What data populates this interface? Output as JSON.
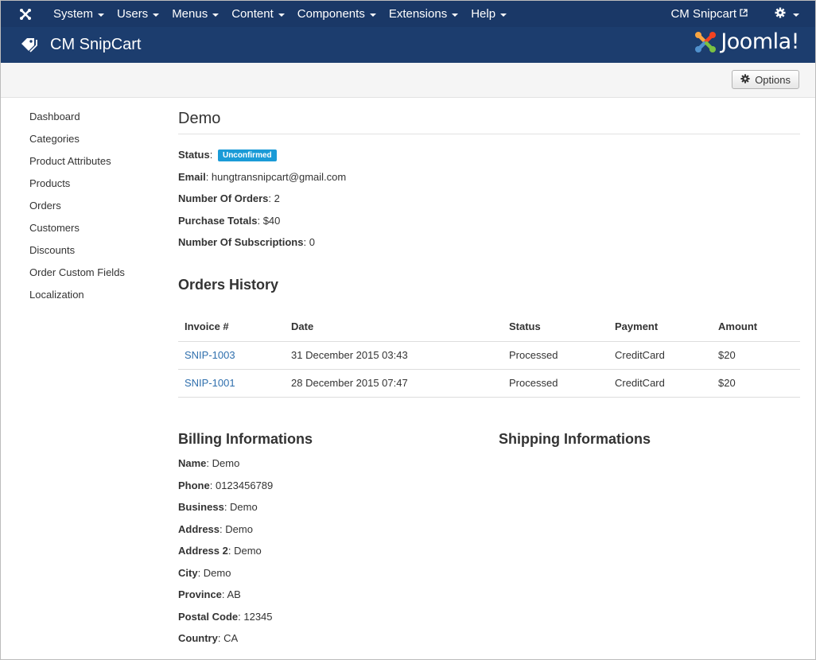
{
  "nav": {
    "items": [
      {
        "label": "System"
      },
      {
        "label": "Users"
      },
      {
        "label": "Menus"
      },
      {
        "label": "Content"
      },
      {
        "label": "Components"
      },
      {
        "label": "Extensions"
      },
      {
        "label": "Help"
      }
    ],
    "site_link": "CM Snipcart",
    "icons": {
      "logo": "joomla-icon",
      "external": "external-link-icon",
      "settings": "gear-icon"
    }
  },
  "header": {
    "title": "CM SnipCart",
    "brand": "Joomla!"
  },
  "toolbar": {
    "options_label": "Options"
  },
  "sidebar": {
    "items": [
      {
        "label": "Dashboard"
      },
      {
        "label": "Categories"
      },
      {
        "label": "Product Attributes"
      },
      {
        "label": "Products"
      },
      {
        "label": "Orders"
      },
      {
        "label": "Customers"
      },
      {
        "label": "Discounts"
      },
      {
        "label": "Order Custom Fields"
      },
      {
        "label": "Localization"
      }
    ]
  },
  "customer": {
    "name": "Demo",
    "status_label": "Status",
    "status": "Unconfirmed",
    "email_label": "Email",
    "email": "hungtransnipcart@gmail.com",
    "orders_label": "Number Of Orders",
    "orders": "2",
    "totals_label": "Purchase Totals",
    "totals": "$40",
    "subs_label": "Number Of Subscriptions",
    "subs": "0"
  },
  "orders_history": {
    "title": "Orders History",
    "columns": [
      "Invoice #",
      "Date",
      "Status",
      "Payment",
      "Amount"
    ],
    "rows": [
      {
        "invoice": "SNIP-1003",
        "date": "31 December 2015 03:43",
        "status": "Processed",
        "payment": "CreditCard",
        "amount": "$20"
      },
      {
        "invoice": "SNIP-1001",
        "date": "28 December 2015 07:47",
        "status": "Processed",
        "payment": "CreditCard",
        "amount": "$20"
      }
    ]
  },
  "billing": {
    "title": "Billing Informations",
    "fields": [
      {
        "label": "Name",
        "value": "Demo"
      },
      {
        "label": "Phone",
        "value": "0123456789"
      },
      {
        "label": "Business",
        "value": "Demo"
      },
      {
        "label": "Address",
        "value": "Demo"
      },
      {
        "label": "Address 2",
        "value": "Demo"
      },
      {
        "label": "City",
        "value": "Demo"
      },
      {
        "label": "Province",
        "value": "AB"
      },
      {
        "label": "Postal Code",
        "value": "12345"
      },
      {
        "label": "Country",
        "value": "CA"
      }
    ]
  },
  "shipping": {
    "title": "Shipping Informations"
  },
  "colors": {
    "navbar": "#1a3867",
    "header": "#1c3d6e",
    "badge": "#1a9bd7",
    "link": "#2f6fad"
  }
}
